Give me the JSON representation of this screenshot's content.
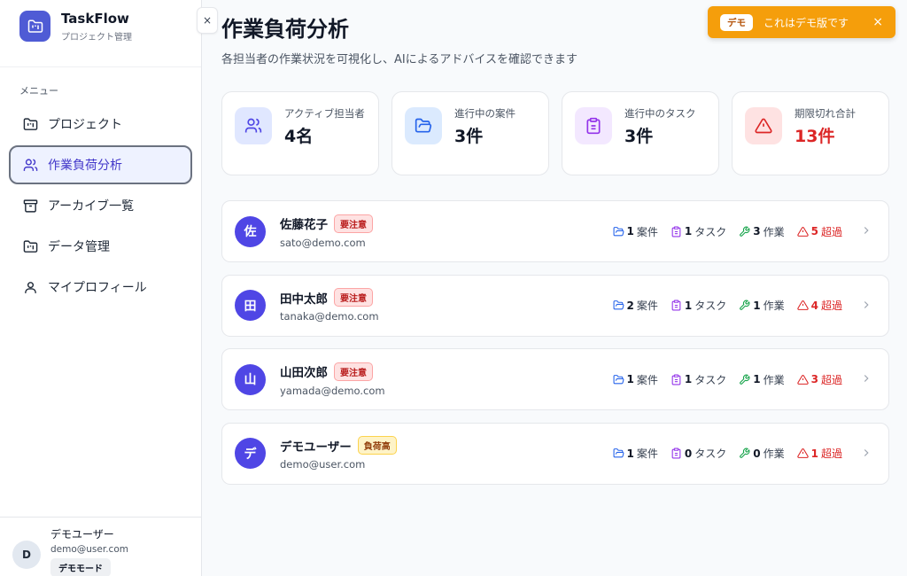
{
  "brand": {
    "name": "TaskFlow",
    "subtitle": "プロジェクト管理"
  },
  "sidebar": {
    "menu_label": "メニュー",
    "collapse_label": "×",
    "items": [
      {
        "label": "プロジェクト",
        "icon": "folder-kanban-icon"
      },
      {
        "label": "作業負荷分析",
        "icon": "users-icon",
        "active": true
      },
      {
        "label": "アーカイブ一覧",
        "icon": "archive-icon"
      },
      {
        "label": "データ管理",
        "icon": "folder-kanban-icon"
      },
      {
        "label": "マイプロフィール",
        "icon": "user-icon"
      }
    ],
    "user": {
      "initial": "D",
      "name": "デモユーザー",
      "email": "demo@user.com",
      "badge": "デモモード"
    }
  },
  "demo_banner": {
    "tag": "デモ",
    "text": "これはデモ版です",
    "close": "×"
  },
  "page": {
    "title": "作業負荷分析",
    "description": "各担当者の作業状況を可視化し、AIによるアドバイスを確認できます"
  },
  "stats": [
    {
      "label": "アクティブ担当者",
      "value": "4名",
      "icon": "users-icon",
      "accent": "#4f46e5",
      "bg": "#e0e7ff"
    },
    {
      "label": "進行中の案件",
      "value": "3件",
      "icon": "folder-open-icon",
      "accent": "#2563eb",
      "bg": "#dbeafe"
    },
    {
      "label": "進行中のタスク",
      "value": "3件",
      "icon": "clipboard-icon",
      "accent": "#9333ea",
      "bg": "#f3e8ff"
    },
    {
      "label": "期限切れ合計",
      "value": "13件",
      "icon": "alert-triangle-icon",
      "accent": "#dc2626",
      "bg": "#fee2e2",
      "danger": true
    }
  ],
  "metric_labels": {
    "projects": "案件",
    "tasks": "タスク",
    "works": "作業",
    "overdue": "超過"
  },
  "people": [
    {
      "initial": "佐",
      "name": "佐藤花子",
      "tag": "要注意",
      "tag_type": "warn",
      "email": "sato@demo.com",
      "projects": "1",
      "tasks": "1",
      "works": "3",
      "overdue": "5"
    },
    {
      "initial": "田",
      "name": "田中太郎",
      "tag": "要注意",
      "tag_type": "warn",
      "email": "tanaka@demo.com",
      "projects": "2",
      "tasks": "1",
      "works": "1",
      "overdue": "4"
    },
    {
      "initial": "山",
      "name": "山田次郎",
      "tag": "要注意",
      "tag_type": "warn",
      "email": "yamada@demo.com",
      "projects": "1",
      "tasks": "1",
      "works": "1",
      "overdue": "3"
    },
    {
      "initial": "デ",
      "name": "デモユーザー",
      "tag": "負荷高",
      "tag_type": "high",
      "email": "demo@user.com",
      "projects": "1",
      "tasks": "0",
      "works": "0",
      "overdue": "1"
    }
  ],
  "colors": {
    "primary": "#4f46e5",
    "folder": "#2563eb",
    "task": "#9333ea",
    "work": "#16a34a",
    "danger": "#dc2626",
    "demo": "#f59e0b"
  }
}
